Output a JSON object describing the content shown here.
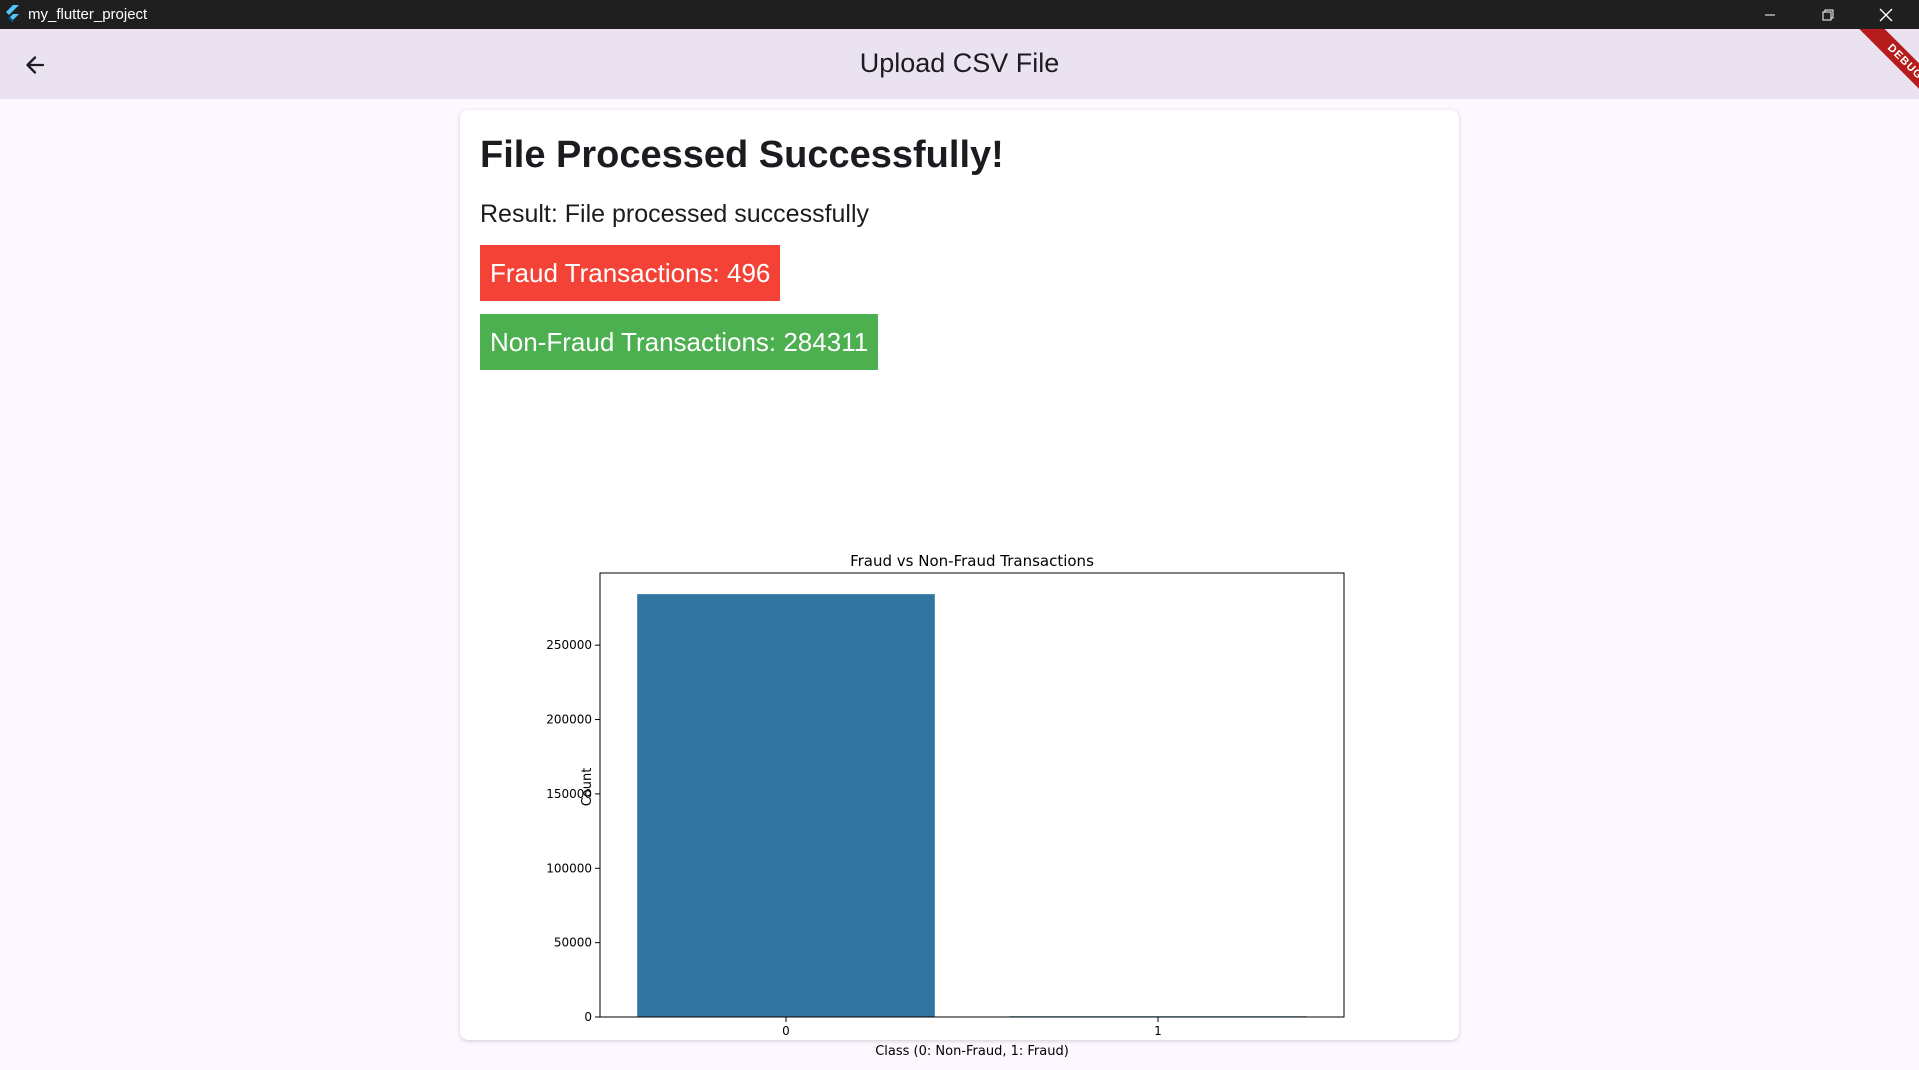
{
  "window": {
    "title": "my_flutter_project",
    "controls": [
      "minimize-icon",
      "restore-icon",
      "close-icon"
    ]
  },
  "appbar": {
    "title": "Upload CSV File",
    "back_icon": "arrow-left-icon",
    "debug_banner": "DEBUG"
  },
  "content": {
    "headline": "File Processed Successfully!",
    "result": "Result: File processed successfully",
    "fraud_label": "Fraud Transactions: 496",
    "nonfraud_label": "Non-Fraud Transactions: 284311"
  },
  "colors": {
    "fraud": "#f44336",
    "nonfraud": "#4caf50",
    "bar": "#3274a1",
    "appbar": "#ebe2f1"
  },
  "chart_data": {
    "type": "bar",
    "title": "Fraud vs Non-Fraud Transactions",
    "xlabel": "Class (0: Non-Fraud, 1: Fraud)",
    "ylabel": "Count",
    "categories": [
      "0",
      "1"
    ],
    "values": [
      284311,
      496
    ],
    "ylim": [
      0,
      298527
    ],
    "yticks": [
      0,
      50000,
      100000,
      150000,
      200000,
      250000
    ],
    "grid": false
  }
}
